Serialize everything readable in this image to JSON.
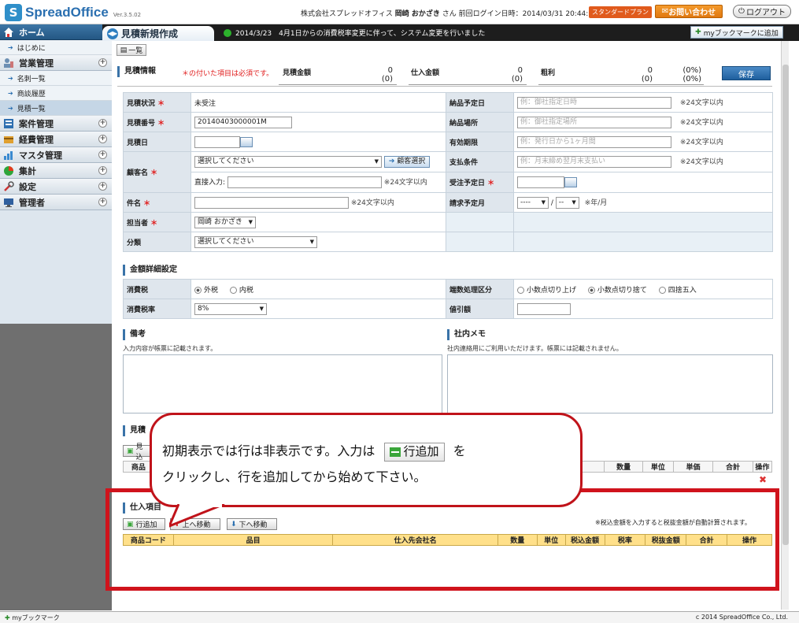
{
  "header": {
    "logo_mark": "S",
    "logo_text": "SpreadOffice",
    "version": "Ver.3.5.02",
    "company": "株式会社スプレッドオフィス",
    "user": "岡崎 おかざき",
    "user_suffix": "さん",
    "last_login": "前回ログイン日時：2014/03/31 20:44:09",
    "plan": "スタンダードプラン",
    "contact": "お問い合わせ",
    "logout": "ログアウト"
  },
  "sidebar": {
    "home": "ホーム",
    "home_sub": "はじめに",
    "sales": "営業管理",
    "sales_items": [
      "名刺一覧",
      "商談履歴",
      "見積一覧"
    ],
    "projects": "案件管理",
    "expenses": "経費管理",
    "master": "マスタ管理",
    "totals": "集計",
    "settings": "設定",
    "admin": "管理者"
  },
  "tab": {
    "title": "見積新規作成"
  },
  "news": "2014/3/23　4月1日からの消費税率変更に伴って、システム変更を行いました",
  "bookmark": "myブックマークに追加",
  "list_button": "一覧",
  "info": {
    "title": "見積情報",
    "required_note": "＊の付いた項目は必須です。",
    "estimate_amount_label": "見積金額",
    "estimate_amount": "0",
    "estimate_amount_paren": "(0)",
    "purchase_amount_label": "仕入金額",
    "purchase_amount": "0",
    "purchase_amount_paren": "(0)",
    "gross_label": "粗利",
    "gross": "0",
    "gross_paren": "(0)",
    "gross_pct": "(0%)",
    "gross_pct2": "(0%)",
    "save": "保存"
  },
  "form": {
    "status_label": "見積状況",
    "status_value": "未受注",
    "number_label": "見積番号",
    "number_value": "20140403000001M",
    "date_label": "見積日",
    "customer_label": "顧客名",
    "customer_select": "選択してください",
    "customer_btn": "顧客選択",
    "direct_label": "直接入力:",
    "limit24": "※24文字以内",
    "subject_label": "件名",
    "owner_label": "担当者",
    "owner_value": "岡崎 おかざき",
    "category_label": "分類",
    "category_value": "選択してください",
    "delivery_date_label": "納品予定日",
    "delivery_date_ph": "例：御社指定日時",
    "delivery_place_label": "納品場所",
    "delivery_place_ph": "例：御社指定場所",
    "validity_label": "有効期限",
    "validity_ph": "例：発行日から1ヶ月間",
    "payment_label": "支払条件",
    "payment_ph": "例：月末締め翌月末支払い",
    "order_date_label": "受注予定日",
    "billing_label": "請求予定月",
    "billing_year": "----",
    "billing_sep": "/",
    "billing_month": "--",
    "billing_note": "※年/月"
  },
  "amount": {
    "title": "金額詳細設定",
    "tax_label": "消費税",
    "tax_opt1": "外税",
    "tax_opt2": "内税",
    "rate_label": "消費税率",
    "rate_value": "8%",
    "rounding_label": "端数処理区分",
    "round_opt1": "小数点切り上げ",
    "round_opt2": "小数点切り捨て",
    "round_opt3": "四捨五入",
    "discount_label": "値引額"
  },
  "notes": {
    "remarks_title": "備考",
    "remarks_desc": "入力内容が帳票に記載されます。",
    "memo_title": "社内メモ",
    "memo_desc": "社内連絡用にご利用いただけます。帳票には記載されません。"
  },
  "estimate_items": {
    "title_partial": "見積",
    "btn_partial": "見込",
    "cols_partial": [
      "商品",
      "数量",
      "単位",
      "単価",
      "合計",
      "操作"
    ]
  },
  "callout": {
    "text1": "初期表示では行は非表示です。入力は",
    "button": "行追加",
    "text2": "を",
    "text3": "クリックし、行を追加してから始めて下さい。"
  },
  "purchase": {
    "title": "仕入項目",
    "add_row": "行追加",
    "move_up": "上へ移動",
    "move_down": "下へ移動",
    "auto_note": "※税込金額を入力すると税抜金額が自動計算されます。",
    "columns": [
      "商品コード",
      "品目",
      "仕入先会社名",
      "数量",
      "単位",
      "税込金額",
      "税率",
      "税抜金額",
      "合計",
      "操作"
    ]
  },
  "footer": {
    "bookmark": "myブックマーク",
    "copyright": "c 2014 SpreadOffice Co., Ltd."
  }
}
